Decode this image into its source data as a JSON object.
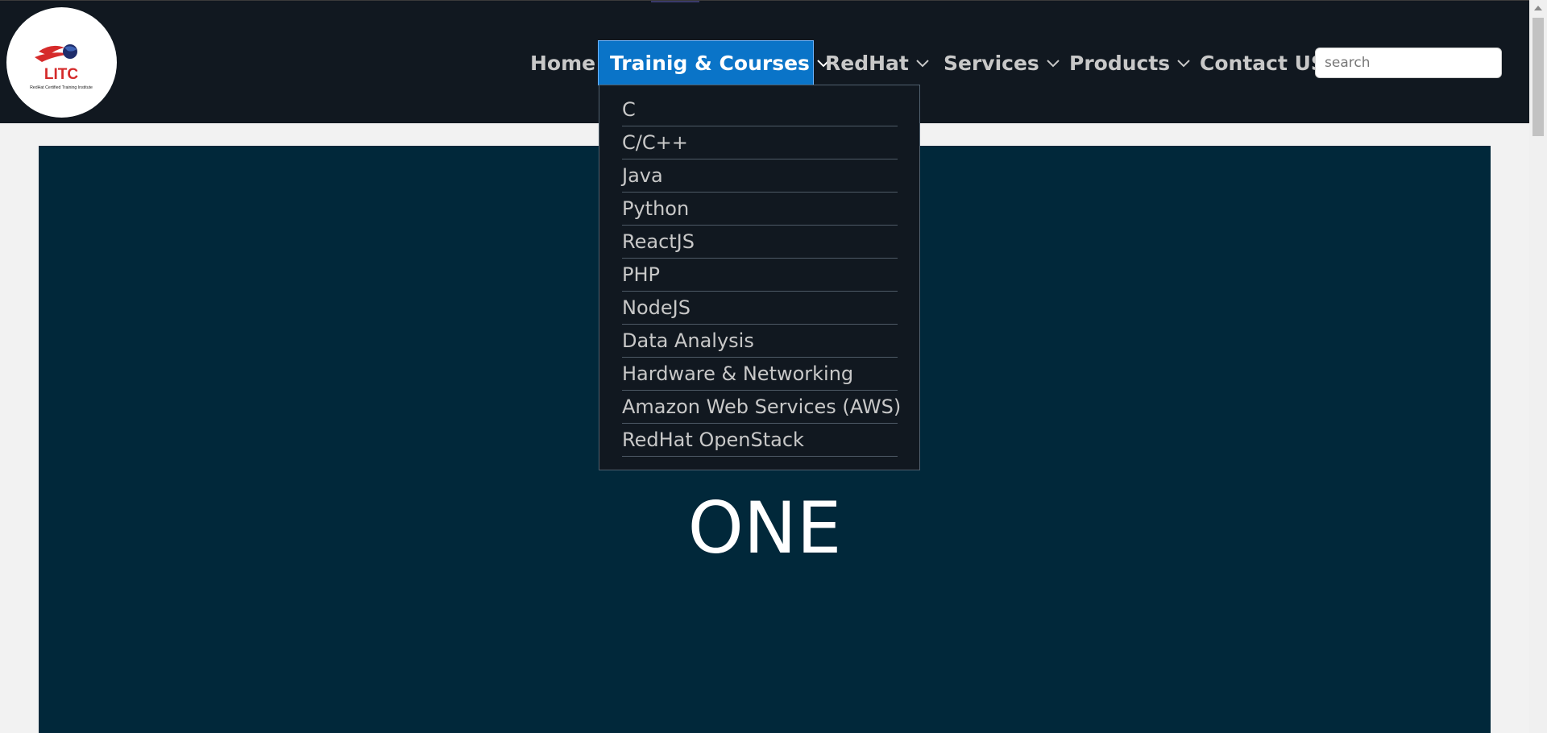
{
  "logo": {
    "name": "LITC",
    "tagline": "RedHat Certified Training Institute"
  },
  "nav": {
    "home": "Home",
    "training": "Trainig & Courses",
    "redhat": "RedHat",
    "services": "Services",
    "products": "Products",
    "contact": "Contact US"
  },
  "search": {
    "placeholder": "search"
  },
  "dropdown": {
    "items": [
      "C",
      "C/C++",
      "Java",
      "Python",
      "ReactJS",
      "PHP",
      "NodeJS",
      "Data Analysis",
      "Hardware & Networking",
      "Amazon Web Services (AWS)",
      "RedHat OpenStack"
    ]
  },
  "hero": {
    "text": "ONE"
  },
  "colors": {
    "navbar": "#111820",
    "active_nav": "#0a74c8",
    "hero": "#01283a"
  }
}
